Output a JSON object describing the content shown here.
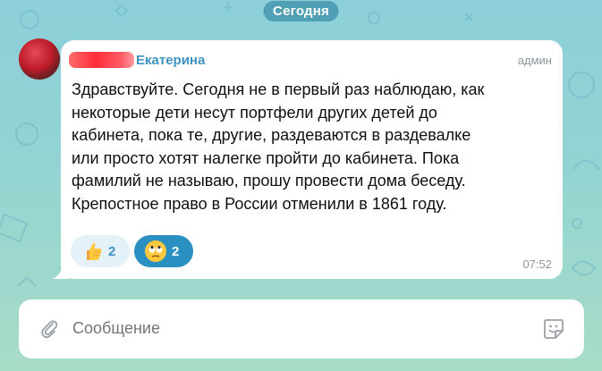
{
  "date_separator": "Сегодня",
  "message": {
    "author_name": "Екатерина",
    "role": "админ",
    "text_lines": [
      "Здравствуйте. Сегодня не в первый раз наблюдаю, как",
      "некоторые дети несут портфели других детей до",
      "кабинета, пока те, другие, раздеваются в раздевалке",
      "или просто хотят налегке пройти до кабинета. Пока",
      "фамилий не называю, прошу провести дома беседу.",
      "Крепостное право в России отменили в 1861 году."
    ],
    "reactions": [
      {
        "emoji": "thumbs-up-emoji",
        "count": "2",
        "selected": false
      },
      {
        "emoji": "rolling-eyes-emoji",
        "count": "2",
        "selected": true
      }
    ],
    "time": "07:52"
  },
  "composer": {
    "placeholder": "Сообщение",
    "attach_icon": "paperclip-icon",
    "sticker_icon": "sticker-icon"
  },
  "colors": {
    "accent": "#3d92bf",
    "selected_reaction": "#2a8fc1",
    "date_pill": "#4f9fb5",
    "redaction": "#ff2d3a"
  }
}
